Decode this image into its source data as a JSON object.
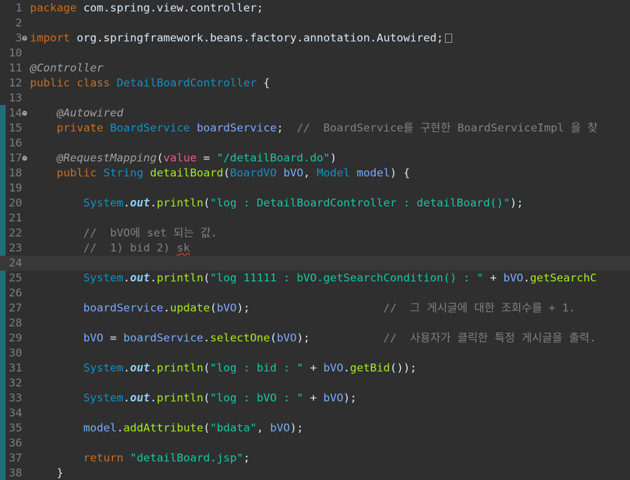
{
  "editor": {
    "lines": [
      {
        "n": "1",
        "t": [
          [
            "kw",
            "package"
          ],
          [
            "pl",
            " com.spring.view.controller;"
          ]
        ]
      },
      {
        "n": "2",
        "t": []
      },
      {
        "n": "3",
        "fold": "plus",
        "t": [
          [
            "kw",
            "import"
          ],
          [
            "pl",
            " org.springframework.beans.factory.annotation.Autowired;"
          ]
        ],
        "collapsed": true
      },
      {
        "n": "10",
        "t": []
      },
      {
        "n": "11",
        "t": [
          [
            "ann",
            "@Controller"
          ]
        ]
      },
      {
        "n": "12",
        "t": [
          [
            "kw",
            "public class"
          ],
          [
            "pl",
            " "
          ],
          [
            "ty",
            "DetailBoardController"
          ],
          [
            "pl",
            " {"
          ]
        ]
      },
      {
        "n": "13",
        "t": []
      },
      {
        "n": "14",
        "fold": "minus",
        "t": [
          [
            "pl",
            "    "
          ],
          [
            "ann",
            "@Autowired"
          ]
        ]
      },
      {
        "n": "15",
        "t": [
          [
            "pl",
            "    "
          ],
          [
            "kw",
            "private"
          ],
          [
            "pl",
            " "
          ],
          [
            "ty",
            "BoardService"
          ],
          [
            "pl",
            " "
          ],
          [
            "var",
            "boardService"
          ],
          [
            "pl",
            ";  "
          ],
          [
            "cmt",
            "//  BoardService를 구현한 BoardServiceImpl 을 찾"
          ]
        ]
      },
      {
        "n": "16",
        "t": []
      },
      {
        "n": "17",
        "fold": "minus",
        "t": [
          [
            "pl",
            "    "
          ],
          [
            "ann",
            "@RequestMapping"
          ],
          [
            "pl",
            "("
          ],
          [
            "attr",
            "value"
          ],
          [
            "pl",
            " = "
          ],
          [
            "str",
            "\"/detailBoard.do\""
          ],
          [
            "pl",
            ")"
          ]
        ]
      },
      {
        "n": "18",
        "t": [
          [
            "pl",
            "    "
          ],
          [
            "kw",
            "public"
          ],
          [
            "pl",
            " "
          ],
          [
            "ty",
            "String"
          ],
          [
            "pl",
            " "
          ],
          [
            "meth",
            "detailBoard"
          ],
          [
            "pl",
            "("
          ],
          [
            "ty",
            "BoardVO"
          ],
          [
            "pl",
            " "
          ],
          [
            "var",
            "bVO"
          ],
          [
            "pl",
            ", "
          ],
          [
            "ty",
            "Model"
          ],
          [
            "pl",
            " "
          ],
          [
            "var",
            "model"
          ],
          [
            "pl",
            ") {"
          ]
        ]
      },
      {
        "n": "19",
        "t": []
      },
      {
        "n": "20",
        "t": [
          [
            "pl",
            "        "
          ],
          [
            "ty",
            "System"
          ],
          [
            "pl",
            "."
          ],
          [
            "fld",
            "out"
          ],
          [
            "pl",
            "."
          ],
          [
            "meth",
            "println"
          ],
          [
            "pl",
            "("
          ],
          [
            "str",
            "\"log : DetailBoardController : detailBoard()\""
          ],
          [
            "pl",
            ");"
          ]
        ]
      },
      {
        "n": "21",
        "t": []
      },
      {
        "n": "22",
        "t": [
          [
            "pl",
            "        "
          ],
          [
            "cmt",
            "//  bVO에 set 되는 값."
          ]
        ]
      },
      {
        "n": "23",
        "t": [
          [
            "pl",
            "        "
          ],
          [
            "cmt",
            "//  1) bid 2) "
          ],
          [
            "cmtsq",
            "sk"
          ]
        ]
      },
      {
        "n": "24",
        "t": [],
        "current": true
      },
      {
        "n": "25",
        "t": [
          [
            "pl",
            "        "
          ],
          [
            "ty",
            "System"
          ],
          [
            "pl",
            "."
          ],
          [
            "fld",
            "out"
          ],
          [
            "pl",
            "."
          ],
          [
            "meth",
            "println"
          ],
          [
            "pl",
            "("
          ],
          [
            "str",
            "\"log 11111 : bVO.getSearchCondition() : \""
          ],
          [
            "pl",
            " + "
          ],
          [
            "var",
            "bVO"
          ],
          [
            "pl",
            "."
          ],
          [
            "meth",
            "getSearchC"
          ]
        ]
      },
      {
        "n": "26",
        "t": []
      },
      {
        "n": "27",
        "t": [
          [
            "pl",
            "        "
          ],
          [
            "var",
            "boardService"
          ],
          [
            "pl",
            "."
          ],
          [
            "meth",
            "update"
          ],
          [
            "pl",
            "("
          ],
          [
            "var",
            "bVO"
          ],
          [
            "pl",
            ");                    "
          ],
          [
            "cmt",
            "//  그 게시글에 대한 조회수를 + 1."
          ]
        ]
      },
      {
        "n": "28",
        "t": []
      },
      {
        "n": "29",
        "t": [
          [
            "pl",
            "        "
          ],
          [
            "var",
            "bVO"
          ],
          [
            "pl",
            " = "
          ],
          [
            "var",
            "boardService"
          ],
          [
            "pl",
            "."
          ],
          [
            "meth",
            "selectOne"
          ],
          [
            "pl",
            "("
          ],
          [
            "var",
            "bVO"
          ],
          [
            "pl",
            ");           "
          ],
          [
            "cmt",
            "//  사용자가 클릭한 특정 게시글을 출력."
          ]
        ]
      },
      {
        "n": "30",
        "t": []
      },
      {
        "n": "31",
        "t": [
          [
            "pl",
            "        "
          ],
          [
            "ty",
            "System"
          ],
          [
            "pl",
            "."
          ],
          [
            "fld",
            "out"
          ],
          [
            "pl",
            "."
          ],
          [
            "meth",
            "println"
          ],
          [
            "pl",
            "("
          ],
          [
            "str",
            "\"log : bid : \""
          ],
          [
            "pl",
            " + "
          ],
          [
            "var",
            "bVO"
          ],
          [
            "pl",
            "."
          ],
          [
            "meth",
            "getBid"
          ],
          [
            "pl",
            "());"
          ]
        ]
      },
      {
        "n": "32",
        "t": []
      },
      {
        "n": "33",
        "t": [
          [
            "pl",
            "        "
          ],
          [
            "ty",
            "System"
          ],
          [
            "pl",
            "."
          ],
          [
            "fld",
            "out"
          ],
          [
            "pl",
            "."
          ],
          [
            "meth",
            "println"
          ],
          [
            "pl",
            "("
          ],
          [
            "str",
            "\"log : bVO : \""
          ],
          [
            "pl",
            " + "
          ],
          [
            "var",
            "bVO"
          ],
          [
            "pl",
            ");"
          ]
        ]
      },
      {
        "n": "34",
        "t": []
      },
      {
        "n": "35",
        "t": [
          [
            "pl",
            "        "
          ],
          [
            "var",
            "model"
          ],
          [
            "pl",
            "."
          ],
          [
            "meth",
            "addAttribute"
          ],
          [
            "pl",
            "("
          ],
          [
            "str",
            "\"bdata\""
          ],
          [
            "pl",
            ", "
          ],
          [
            "var",
            "bVO"
          ],
          [
            "pl",
            ");"
          ]
        ]
      },
      {
        "n": "36",
        "t": []
      },
      {
        "n": "37",
        "t": [
          [
            "pl",
            "        "
          ],
          [
            "kw",
            "return"
          ],
          [
            "pl",
            " "
          ],
          [
            "str",
            "\"detailBoard.jsp\""
          ],
          [
            "pl",
            ";"
          ]
        ]
      },
      {
        "n": "38",
        "t": [
          [
            "pl",
            "    }"
          ]
        ]
      }
    ]
  }
}
